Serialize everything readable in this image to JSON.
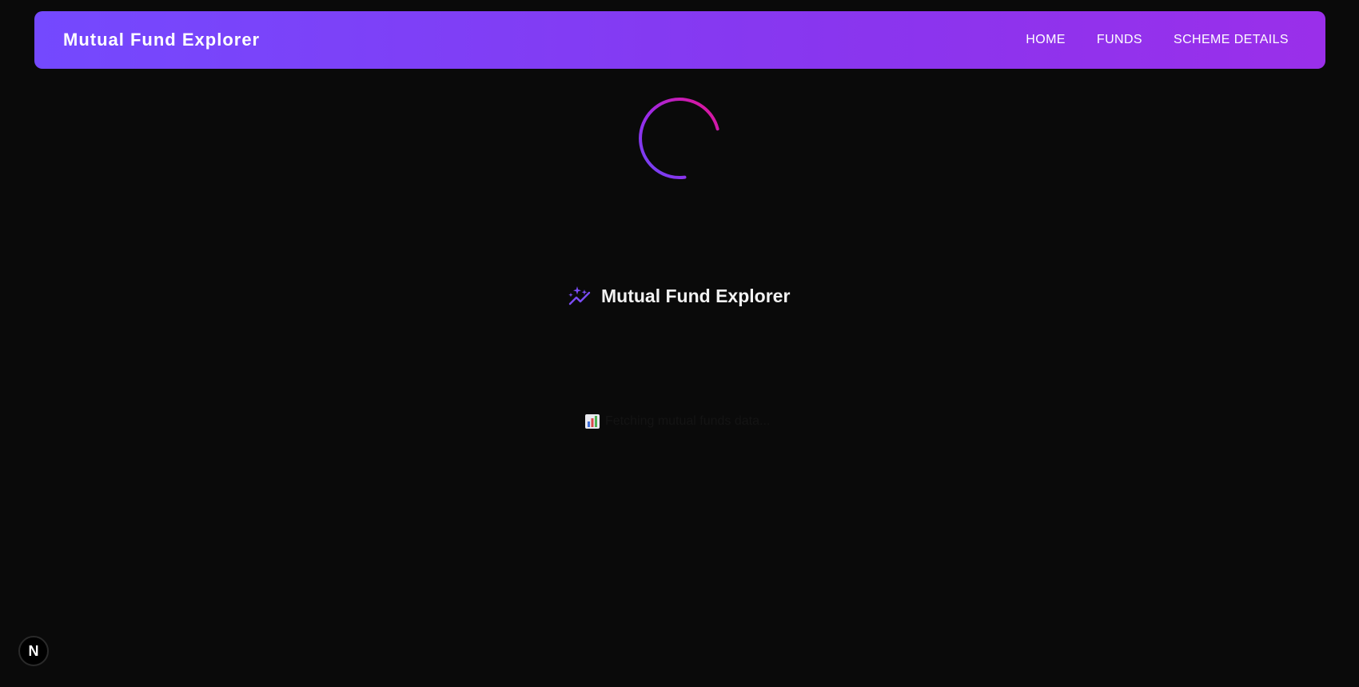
{
  "navbar": {
    "brand": "Mutual Fund Explorer",
    "links": [
      "HOME",
      "FUNDS",
      "SCHEME DETAILS"
    ]
  },
  "loading": {
    "title": "Mutual Fund Explorer",
    "title_icon": "sparkle-chart-icon",
    "status_icon": "bar-chart-emoji-icon",
    "status_text": "Fetching mutual funds data..."
  },
  "badge": {
    "letter": "N",
    "icon": "nextjs-logo-icon"
  },
  "colors": {
    "background": "#0a0a0a",
    "navbar_gradient_start": "#7449fe",
    "navbar_gradient_end": "#9a2fea",
    "spinner_start": "#e8128f",
    "spinner_end": "#6d46f5",
    "accent_icon": "#7b4cf7"
  }
}
